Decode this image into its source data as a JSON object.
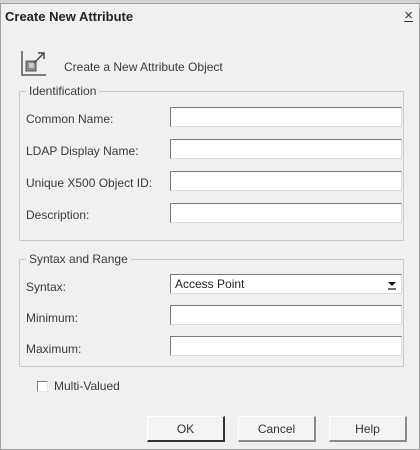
{
  "dialog": {
    "title": "Create New Attribute",
    "close_glyph": "×",
    "header_text": "Create a New Attribute Object",
    "header_icon": "attribute-object-icon"
  },
  "identification": {
    "group_label": "Identification",
    "common_name": {
      "label": "Common Name:",
      "value": ""
    },
    "ldap_display_name": {
      "label": "LDAP Display Name:",
      "value": ""
    },
    "unique_x500_oid": {
      "label": "Unique X500 Object ID:",
      "value": ""
    },
    "description": {
      "label": "Description:",
      "value": ""
    }
  },
  "syntax_range": {
    "group_label": "Syntax and Range",
    "syntax": {
      "label": "Syntax:",
      "selected": "Access Point"
    },
    "minimum": {
      "label": "Minimum:",
      "value": ""
    },
    "maximum": {
      "label": "Maximum:",
      "value": ""
    }
  },
  "multi_valued": {
    "label": "Multi-Valued",
    "checked": false
  },
  "buttons": {
    "ok": "OK",
    "cancel": "Cancel",
    "help": "Help"
  }
}
